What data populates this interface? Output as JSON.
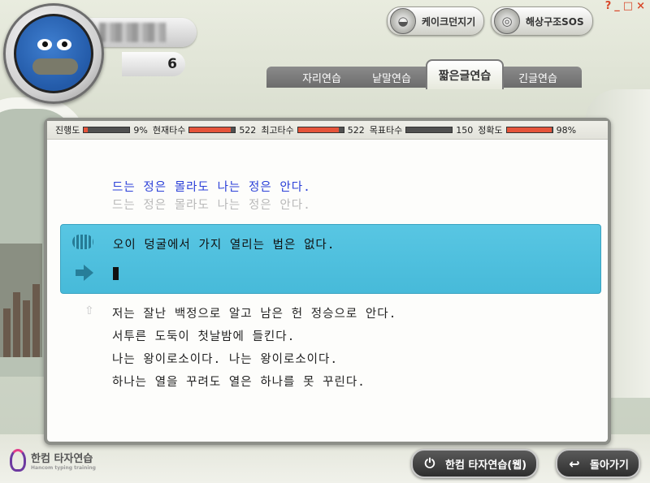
{
  "window": {
    "help": "?",
    "minimize": "_",
    "maximize": "□",
    "close": "×"
  },
  "profile": {
    "level": "6"
  },
  "top_buttons": [
    {
      "label": "케이크던지기",
      "icon": "cake-icon"
    },
    {
      "label": "해상구조SOS",
      "icon": "lifebuoy-icon"
    }
  ],
  "tabs": [
    {
      "label": "자리연습",
      "active": false
    },
    {
      "label": "낱말연습",
      "active": false
    },
    {
      "label": "짧은글연습",
      "active": true
    },
    {
      "label": "긴글연습",
      "active": false
    }
  ],
  "stats": [
    {
      "label": "진행도",
      "value": "9%",
      "fill": 0.09
    },
    {
      "label": "현재타수",
      "value": "522",
      "fill": 0.9
    },
    {
      "label": "최고타수",
      "value": "522",
      "fill": 0.9
    },
    {
      "label": "목표타수",
      "value": "150",
      "fill": 0.0
    },
    {
      "label": "정확도",
      "value": "98%",
      "fill": 0.98
    }
  ],
  "previous": {
    "target": "드는 정은 몰라도 나는 정은 안다.",
    "typed": "드는 정은 몰라도 나는 정은 안다."
  },
  "current": {
    "sentence": "오이 덩굴에서 가지 열리는 법은 없다.",
    "input": ""
  },
  "queue": [
    "저는 잘난 백정으로 알고 남은 헌 정승으로 안다.",
    "서투른 도둑이 첫날밤에 들킨다.",
    "나는 왕이로소이다. 나는 왕이로소이다.",
    "하나는 열을 꾸려도 열은 하나를 못 꾸린다."
  ],
  "bottom": {
    "brand": "한컴 타자연습",
    "brand_sub": "Hancom typing training",
    "web_button": "한컴 타자연습(웹)",
    "back_button": "돌아가기"
  },
  "colors": {
    "accent": "#4fc1df",
    "typed_blue": "#2b40d8",
    "bar_fill": "#e5533a"
  }
}
